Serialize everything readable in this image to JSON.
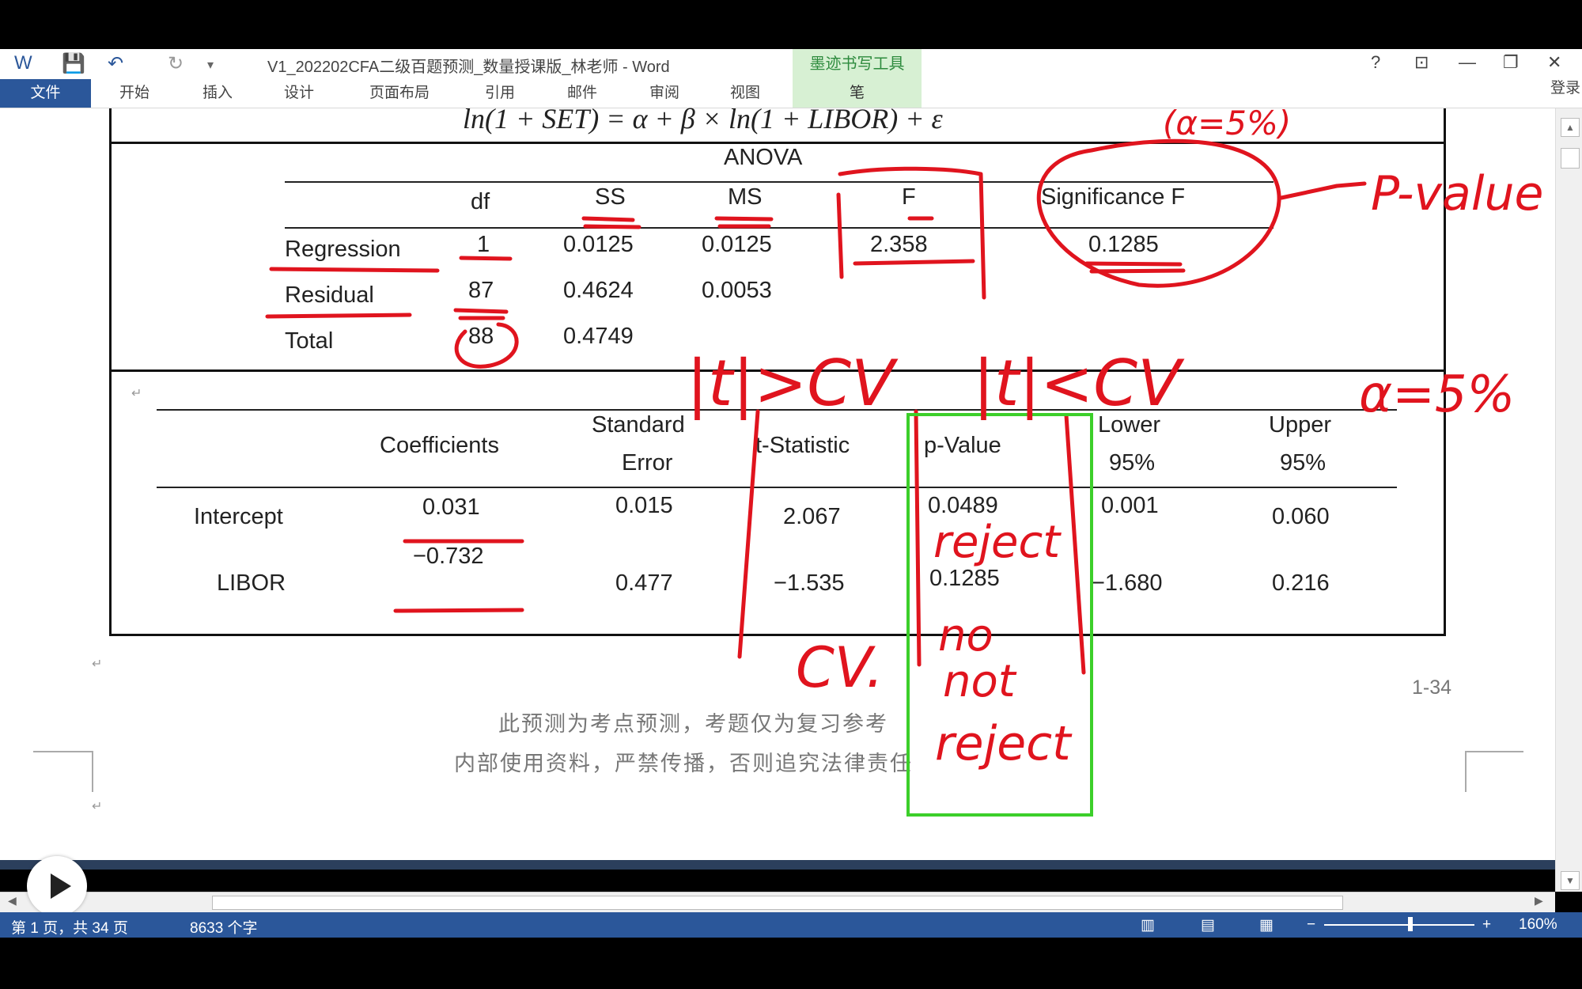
{
  "app": {
    "doc_title": "V1_202202CFA二级百题预测_数量授课版_林老师 - Word",
    "ink_tools_title": "墨迹书写工具",
    "login": "登录"
  },
  "ribbon": {
    "tabs": [
      "文件",
      "开始",
      "插入",
      "设计",
      "页面布局",
      "引用",
      "邮件",
      "审阅",
      "视图",
      "笔"
    ]
  },
  "window_controls": [
    "?",
    "⊡",
    "—",
    "❐",
    "✕"
  ],
  "document": {
    "equation": "ln(1 + SET) = α + β × ln(1 + LIBOR) + ε",
    "anova": {
      "title": "ANOVA",
      "headers": [
        "df",
        "SS",
        "MS",
        "F",
        "Significance F"
      ],
      "rows": [
        {
          "label": "Regression",
          "df": "1",
          "ss": "0.0125",
          "ms": "0.0125",
          "f": "2.358",
          "sig": "0.1285"
        },
        {
          "label": "Residual",
          "df": "87",
          "ss": "0.4624",
          "ms": "0.0053",
          "f": "",
          "sig": ""
        },
        {
          "label": "Total",
          "df": "88",
          "ss": "0.4749",
          "ms": "",
          "f": "",
          "sig": ""
        }
      ]
    },
    "coef": {
      "headers": {
        "coefficients": "Coefficients",
        "std_err_1": "Standard",
        "std_err_2": "Error",
        "t_stat": "t-Statistic",
        "p_value": "p-Value",
        "lower_1": "Lower",
        "lower_2": "95%",
        "upper_1": "Upper",
        "upper_2": "95%"
      },
      "rows": [
        {
          "label": "Intercept",
          "coef": "0.031",
          "se": "0.015",
          "t": "2.067",
          "p": "0.0489",
          "lower": "0.001",
          "upper": "0.060"
        },
        {
          "label": "LIBOR",
          "coef": "−0.732",
          "se": "0.477",
          "t": "−1.535",
          "p": "0.1285",
          "lower": "−1.680",
          "upper": "0.216"
        }
      ]
    },
    "page_number": "1-34",
    "footer_1": "此预测为考点预测，考题仅为复习参考",
    "footer_2": "内部使用资料，严禁传播，否则追究法律责任"
  },
  "annotations": {
    "p_value": "P-value",
    "alpha": "α=5%",
    "rule_reject": "|t|>CV",
    "rule_not_reject": "|t|<CV",
    "cv": "CV.",
    "reject": "reject",
    "no": "no",
    "not": "not",
    "reject2": "reject",
    "top_fragment": "(α=5%)",
    "ink_color": "#e0141e",
    "highlight_color": "#3ccf2a"
  },
  "status": {
    "page": "第 1 页，共 34 页",
    "words": "8633 个字",
    "zoom": "160%"
  }
}
